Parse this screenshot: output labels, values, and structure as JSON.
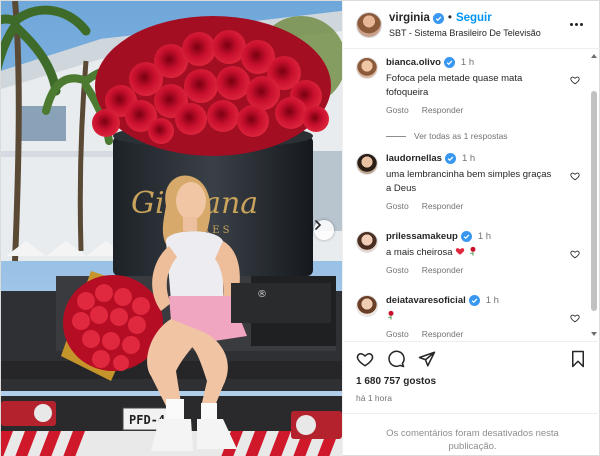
{
  "header": {
    "username": "virginia",
    "separator": "•",
    "follow_label": "Seguir",
    "subtitle": "SBT - Sistema Brasileiro De Televisão"
  },
  "comments": [
    {
      "username": "bianca.olivo",
      "verified": true,
      "time": "1 h",
      "text": "Fofoca pela metade quase mata fofoqueira",
      "like_label": "Gosto",
      "reply_label": "Responder",
      "view_replies": "Ver todas as 1 respostas"
    },
    {
      "username": "laudornellas",
      "verified": true,
      "time": "1 h",
      "text": "uma lembrancinha bem simples graças a Deus",
      "like_label": "Gosto",
      "reply_label": "Responder"
    },
    {
      "username": "prilessamakeup",
      "verified": true,
      "time": "1 h",
      "text": "a mais cheirosa",
      "like_label": "Gosto",
      "reply_label": "Responder"
    },
    {
      "username": "deiatavaresoficial",
      "verified": true,
      "time": "1 h",
      "text": "",
      "like_label": "Gosto",
      "reply_label": "Responder"
    }
  ],
  "likes": "1 680 757 gostos",
  "time_ago": "há 1 hora",
  "comments_disabled": "Os comentários foram desativados nesta publicação.",
  "photo": {
    "truck_sign": "Giuliana",
    "truck_sign_small": "FLORES",
    "plate": "PFD-4"
  },
  "colors": {
    "accent": "#0095f6",
    "verified": "#3897f0",
    "rose_red": "#c8102e",
    "heart_red": "#ed4956"
  },
  "icons": [
    "verified-icon",
    "more-options-icon",
    "heart-icon",
    "comment-icon",
    "share-icon",
    "bookmark-icon",
    "chevron-right-icon"
  ]
}
